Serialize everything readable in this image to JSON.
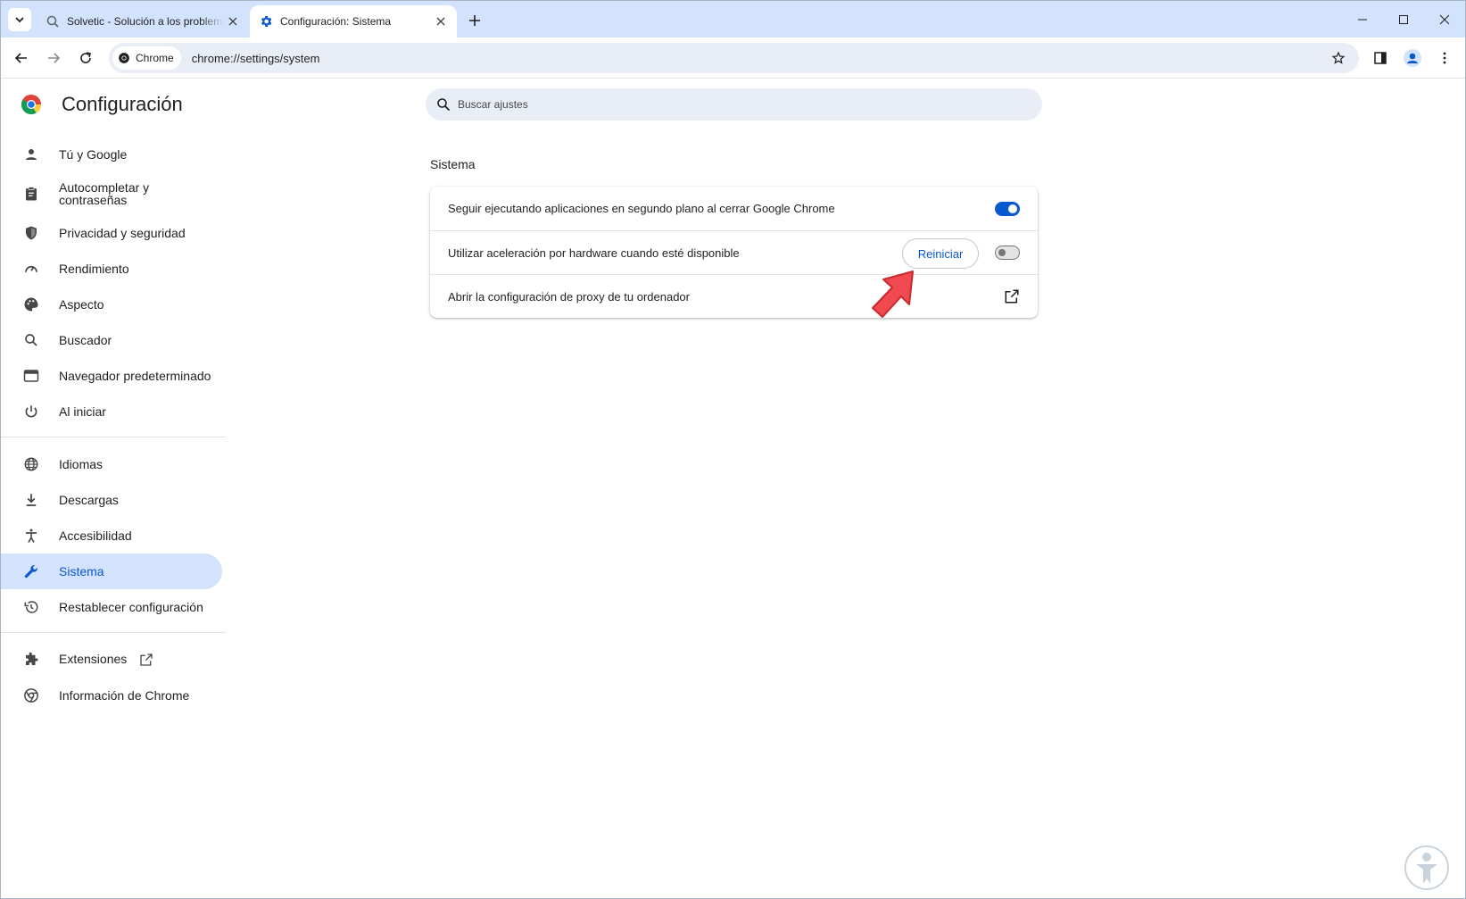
{
  "browser": {
    "tabs": [
      {
        "title": "Solvetic - Solución a los problemas"
      },
      {
        "title": "Configuración: Sistema"
      }
    ],
    "omnibox": {
      "chip_label": "Chrome",
      "url": "chrome://settings/system"
    }
  },
  "settings": {
    "title": "Configuración",
    "search_placeholder": "Buscar ajustes",
    "nav": [
      {
        "label": "Tú y Google",
        "icon": "person-icon"
      },
      {
        "label": "Autocompletar y contraseñas",
        "icon": "clipboard-icon"
      },
      {
        "label": "Privacidad y seguridad",
        "icon": "shield-icon"
      },
      {
        "label": "Rendimiento",
        "icon": "speedometer-icon"
      },
      {
        "label": "Aspecto",
        "icon": "palette-icon"
      },
      {
        "label": "Buscador",
        "icon": "search-icon"
      },
      {
        "label": "Navegador predeterminado",
        "icon": "browser-window-icon"
      },
      {
        "label": "Al iniciar",
        "icon": "power-icon"
      },
      {
        "label": "Idiomas",
        "icon": "globe-icon"
      },
      {
        "label": "Descargas",
        "icon": "download-icon"
      },
      {
        "label": "Accesibilidad",
        "icon": "accessibility-icon"
      },
      {
        "label": "Sistema",
        "icon": "wrench-icon",
        "selected": true
      },
      {
        "label": "Restablecer configuración",
        "icon": "history-icon"
      },
      {
        "label": "Extensiones",
        "icon": "puzzle-icon"
      },
      {
        "label": "Información de Chrome",
        "icon": "chrome-icon"
      }
    ]
  },
  "system": {
    "section_title": "Sistema",
    "rows": [
      {
        "label": "Seguir ejecutando aplicaciones en segundo plano al cerrar Google Chrome",
        "toggle": true
      },
      {
        "label": "Utilizar aceleración por hardware cuando esté disponible",
        "toggle": false,
        "button": "Reiniciar"
      },
      {
        "label": "Abrir la configuración de proxy de tu ordenador",
        "icon": "open-in-new-icon"
      }
    ]
  },
  "colors": {
    "accent": "#0b57d0",
    "selected_bg": "#d3e3fd",
    "annotation_arrow": "#f0494f"
  }
}
